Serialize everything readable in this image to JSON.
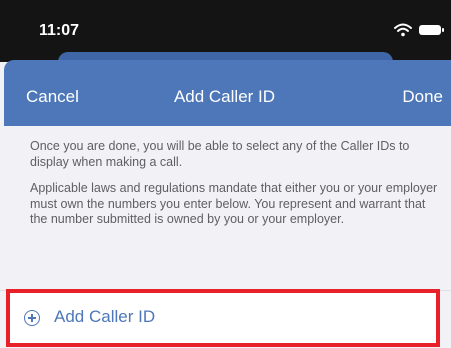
{
  "status_bar": {
    "time": "11:07",
    "icons": [
      "wifi-icon",
      "battery-icon"
    ]
  },
  "nav": {
    "cancel_label": "Cancel",
    "title": "Add Caller ID",
    "done_label": "Done"
  },
  "content": {
    "paragraph_1": "Once you are done, you will be able to select any of the Caller IDs to display when making a call.",
    "paragraph_2": "Applicable laws and regulations mandate that either you or your employer must own the numbers you enter below. You represent and warrant that the number submitted is owned by you or your employer."
  },
  "add_row": {
    "icon": "plus-circle-icon",
    "label": "Add Caller ID"
  },
  "colors": {
    "nav_background": "#4d77b8",
    "accent": "#4d77b8",
    "highlight_border": "#e8202a",
    "status_bar_background": "#141414"
  }
}
